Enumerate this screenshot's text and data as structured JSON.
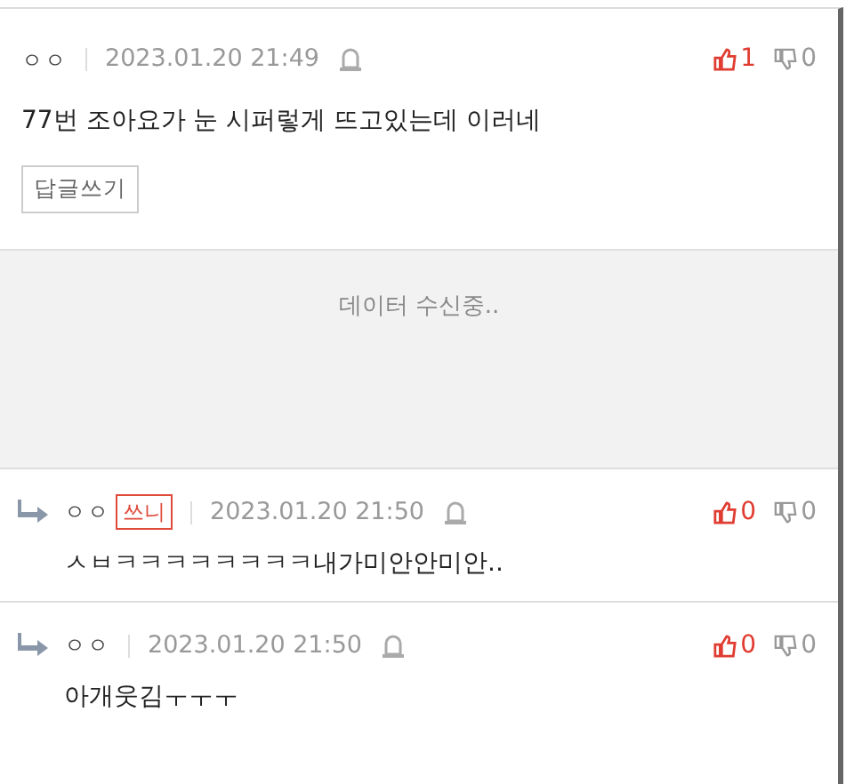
{
  "comments": [
    {
      "author": "ㅇㅇ",
      "time": "2023.01.20 21:49",
      "text": "77번 조아요가 눈 시퍼렇게 뜨고있는데 이러네",
      "likes": "1",
      "dislikes": "0",
      "reply_button": "답글쓰기"
    }
  ],
  "loading": {
    "text": "데이터 수신중.."
  },
  "replies": [
    {
      "author": "ㅇㅇ",
      "badge": "쓰니",
      "time": "2023.01.20 21:50",
      "text": "ㅅㅂㅋㅋㅋㅋㅋㅋㅋㅋ내가미안안미안..",
      "likes": "0",
      "dislikes": "0"
    },
    {
      "author": "ㅇㅇ",
      "time": "2023.01.20 21:50",
      "text": "아개웃김ㅜㅜㅜ",
      "likes": "0",
      "dislikes": "0"
    }
  ]
}
